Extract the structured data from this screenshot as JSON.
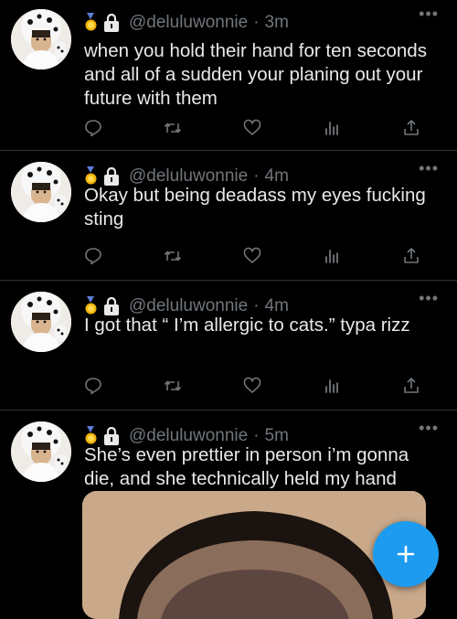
{
  "tweets": [
    {
      "handle": "@deluluwonnie",
      "time": "3m",
      "text": "when you hold their hand for ten seconds and all of a sudden your planing out your future with them"
    },
    {
      "handle": "@deluluwonnie",
      "time": "4m",
      "text": "Okay but being deadass my eyes fucking sting"
    },
    {
      "handle": "@deluluwonnie",
      "time": "4m",
      "text": "I got that “ I’m allergic to cats.” typa rizz"
    },
    {
      "handle": "@deluluwonnie",
      "time": "5m",
      "text": "She’s even prettier in person i’m gonna die, and she technically held my hand"
    }
  ],
  "separator": "·",
  "more_label": "•••",
  "colors": {
    "background": "#000000",
    "text": "#e7e9ea",
    "muted": "#71767b",
    "accent": "#1d9bf0",
    "divider": "#2f3336"
  },
  "icons": {
    "reply": "reply-icon",
    "retweet": "retweet-icon",
    "like": "heart-icon",
    "views": "views-icon",
    "share": "share-icon",
    "compose": "plus-icon"
  }
}
